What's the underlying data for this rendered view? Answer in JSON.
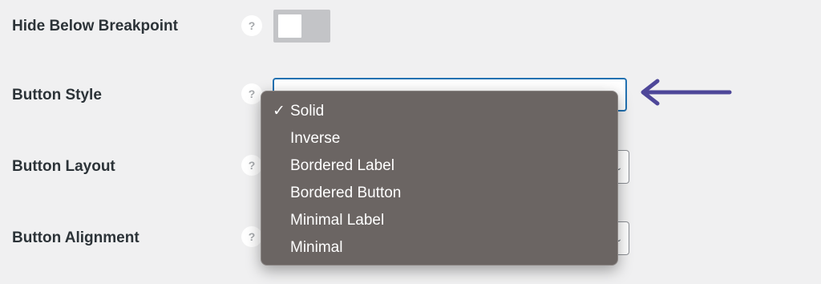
{
  "settings": {
    "rows": [
      {
        "label": "Hide Below Breakpoint"
      },
      {
        "label": "Button Style"
      },
      {
        "label": "Button Layout"
      },
      {
        "label": "Button Alignment"
      }
    ],
    "help_glyph": "?"
  },
  "dropdown": {
    "selected_check": "✓",
    "options": [
      {
        "label": "Solid",
        "selected": true
      },
      {
        "label": "Inverse"
      },
      {
        "label": "Bordered Label"
      },
      {
        "label": "Bordered Button"
      },
      {
        "label": "Minimal Label"
      },
      {
        "label": "Minimal"
      }
    ]
  },
  "colors": {
    "focus_border": "#2271b1",
    "menu_background": "#6b6563",
    "annotation_arrow": "#4e4799",
    "toggle_off": "#c3c4c7"
  },
  "toggle": {
    "state": "off"
  }
}
